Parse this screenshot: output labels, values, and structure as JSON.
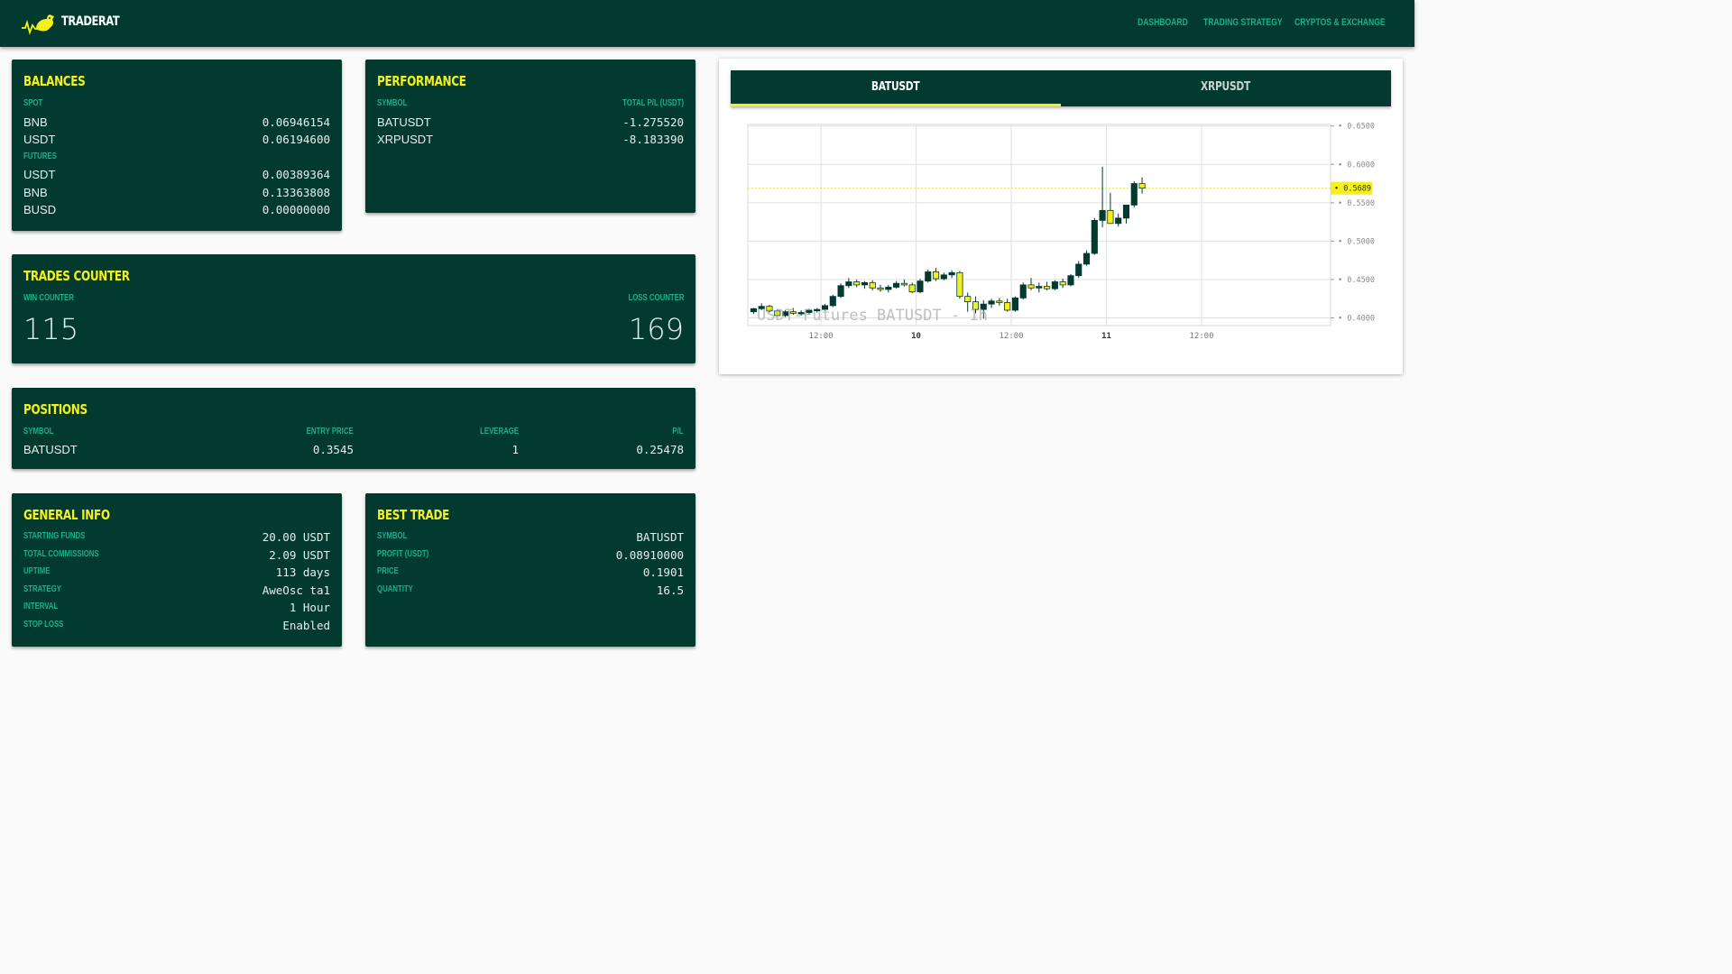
{
  "app": {
    "brand": "TRADERAT",
    "nav": [
      "DASHBOARD",
      "TRADING STRATEGY",
      "CRYPTOS & EXCHANGE"
    ]
  },
  "colors": {
    "primary": "#033a30",
    "accent": "#f4f01e",
    "label": "#17b286",
    "text": "#e8eeec"
  },
  "balances": {
    "title": "BALANCES",
    "spot_label": "SPOT",
    "spot": [
      {
        "asset": "BNB",
        "amount": "0.06946154"
      },
      {
        "asset": "USDT",
        "amount": "0.06194600"
      }
    ],
    "futures_label": "FUTURES",
    "futures": [
      {
        "asset": "USDT",
        "amount": "0.00389364"
      },
      {
        "asset": "BNB",
        "amount": "0.13363808"
      },
      {
        "asset": "BUSD",
        "amount": "0.00000000"
      }
    ]
  },
  "performance": {
    "title": "PERFORMANCE",
    "col_symbol": "SYMBOL",
    "col_pl": "TOTAL P/L (USDT)",
    "rows": [
      {
        "symbol": "BATUSDT",
        "pl": "-1.275520"
      },
      {
        "symbol": "XRPUSDT",
        "pl": "-8.183390"
      }
    ]
  },
  "trades_counter": {
    "title": "TRADES COUNTER",
    "win_label": "WIN COUNTER",
    "loss_label": "LOSS COUNTER",
    "win": "115",
    "loss": "169"
  },
  "positions": {
    "title": "POSITIONS",
    "headers": [
      "SYMBOL",
      "ENTRY PRICE",
      "LEVERAGE",
      "P/L"
    ],
    "rows": [
      {
        "symbol": "BATUSDT",
        "entry": "0.3545",
        "leverage": "1",
        "pl": "0.25478"
      }
    ]
  },
  "general_info": {
    "title": "GENERAL INFO",
    "rows": [
      {
        "label": "STARTING FUNDS",
        "value": "20.00 USDT"
      },
      {
        "label": "TOTAL COMMISSIONS",
        "value": "2.09 USDT"
      },
      {
        "label": "UPTIME",
        "value": "113 days"
      },
      {
        "label": "STRATEGY",
        "value": "AweOsc ta1"
      },
      {
        "label": "INTERVAL",
        "value": "1 Hour"
      },
      {
        "label": "STOP LOSS",
        "value": "Enabled"
      }
    ]
  },
  "best_trade": {
    "title": "BEST TRADE",
    "rows": [
      {
        "label": "SYMBOL",
        "value": "BATUSDT"
      },
      {
        "label": "PROFIT (USDT)",
        "value": "0.08910000"
      },
      {
        "label": "PRICE",
        "value": "0.1901"
      },
      {
        "label": "QUANTITY",
        "value": "16.5"
      }
    ]
  },
  "chart_tabs": {
    "active": "BATUSDT",
    "inactive": "XRPUSDT"
  },
  "chart_data": {
    "type": "candlestick",
    "watermark": "USDT-Futures BATUSDT - 1h",
    "y_ticks": [
      "0.4000",
      "0.4500",
      "0.5000",
      "0.5500",
      "0.6000",
      "0.6500"
    ],
    "x_ticks": [
      "12:00",
      "10",
      "12:00",
      "11",
      "12:00"
    ],
    "last_price": "0.5689",
    "ylim": [
      0.39,
      0.652
    ],
    "candles": [
      [
        0.408,
        0.413,
        0.405,
        0.412
      ],
      [
        0.412,
        0.419,
        0.41,
        0.415
      ],
      [
        0.415,
        0.417,
        0.407,
        0.409
      ],
      [
        0.409,
        0.411,
        0.402,
        0.403
      ],
      [
        0.403,
        0.41,
        0.401,
        0.408
      ],
      [
        0.408,
        0.413,
        0.404,
        0.406
      ],
      [
        0.406,
        0.41,
        0.403,
        0.407
      ],
      [
        0.407,
        0.412,
        0.405,
        0.41
      ],
      [
        0.41,
        0.413,
        0.407,
        0.411
      ],
      [
        0.411,
        0.418,
        0.409,
        0.416
      ],
      [
        0.416,
        0.43,
        0.414,
        0.428
      ],
      [
        0.428,
        0.445,
        0.426,
        0.442
      ],
      [
        0.442,
        0.452,
        0.439,
        0.447
      ],
      [
        0.447,
        0.45,
        0.44,
        0.443
      ],
      [
        0.443,
        0.448,
        0.438,
        0.446
      ],
      [
        0.446,
        0.449,
        0.436,
        0.439
      ],
      [
        0.439,
        0.443,
        0.434,
        0.437
      ],
      [
        0.437,
        0.443,
        0.433,
        0.44
      ],
      [
        0.44,
        0.448,
        0.438,
        0.445
      ],
      [
        0.445,
        0.45,
        0.441,
        0.443
      ],
      [
        0.443,
        0.446,
        0.432,
        0.434
      ],
      [
        0.434,
        0.451,
        0.432,
        0.448
      ],
      [
        0.448,
        0.463,
        0.446,
        0.46
      ],
      [
        0.46,
        0.465,
        0.448,
        0.451
      ],
      [
        0.451,
        0.459,
        0.449,
        0.456
      ],
      [
        0.456,
        0.462,
        0.452,
        0.459
      ],
      [
        0.459,
        0.461,
        0.425,
        0.428
      ],
      [
        0.428,
        0.433,
        0.408,
        0.421
      ],
      [
        0.421,
        0.428,
        0.406,
        0.411
      ],
      [
        0.411,
        0.423,
        0.399,
        0.418
      ],
      [
        0.418,
        0.425,
        0.413,
        0.422
      ],
      [
        0.422,
        0.426,
        0.416,
        0.42
      ],
      [
        0.42,
        0.425,
        0.408,
        0.41
      ],
      [
        0.41,
        0.428,
        0.408,
        0.426
      ],
      [
        0.426,
        0.446,
        0.424,
        0.443
      ],
      [
        0.443,
        0.452,
        0.436,
        0.439
      ],
      [
        0.439,
        0.446,
        0.433,
        0.441
      ],
      [
        0.441,
        0.447,
        0.436,
        0.438
      ],
      [
        0.438,
        0.449,
        0.436,
        0.447
      ],
      [
        0.447,
        0.451,
        0.439,
        0.443
      ],
      [
        0.443,
        0.457,
        0.441,
        0.455
      ],
      [
        0.455,
        0.474,
        0.452,
        0.47
      ],
      [
        0.47,
        0.488,
        0.468,
        0.484
      ],
      [
        0.484,
        0.53,
        0.482,
        0.527
      ],
      [
        0.527,
        0.597,
        0.518,
        0.54
      ],
      [
        0.54,
        0.563,
        0.525,
        0.523
      ],
      [
        0.523,
        0.536,
        0.519,
        0.53
      ],
      [
        0.53,
        0.541,
        0.523,
        0.547
      ],
      [
        0.547,
        0.578,
        0.544,
        0.575
      ],
      [
        0.575,
        0.583,
        0.562,
        0.569
      ]
    ]
  }
}
